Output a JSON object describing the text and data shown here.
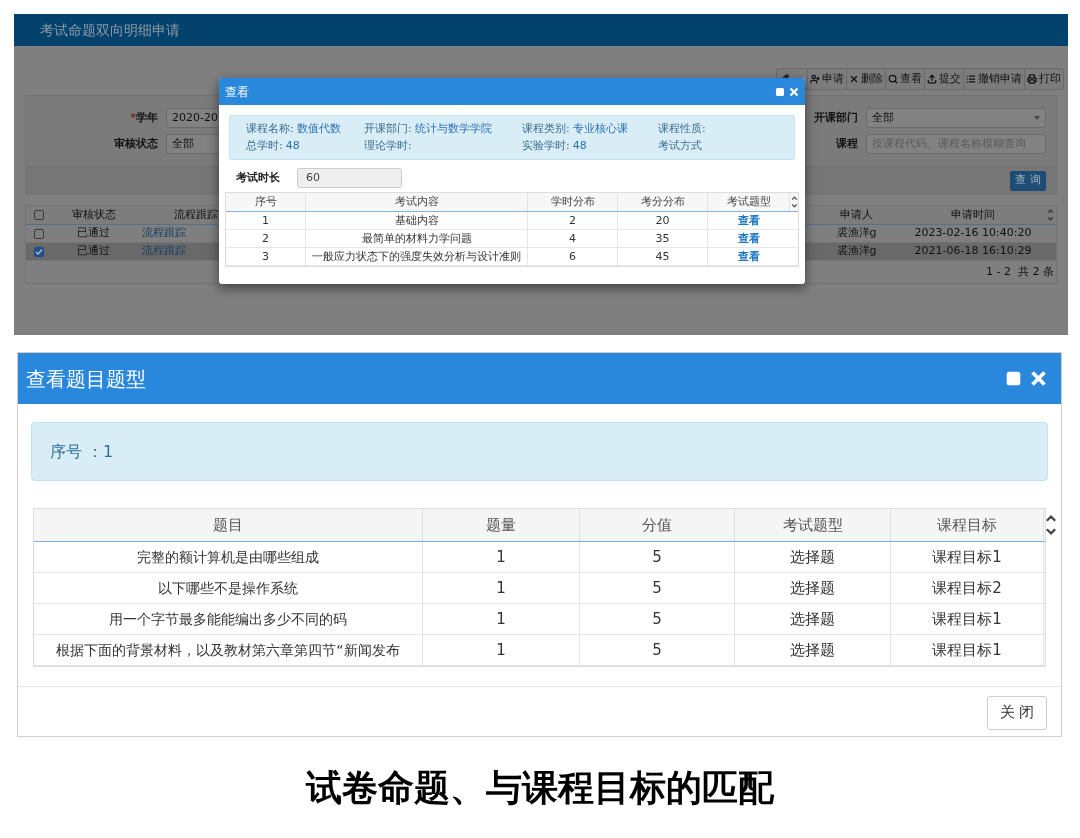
{
  "page": {
    "title": "考试命题双向明细申请",
    "toolbar": [
      {
        "kind": "edit"
      },
      {
        "kind": "apply",
        "label": "申请"
      },
      {
        "kind": "delete",
        "label": "删除"
      },
      {
        "kind": "view",
        "label": "查看"
      },
      {
        "kind": "submit",
        "label": "提交"
      },
      {
        "kind": "revoke",
        "label": "撤销申请"
      },
      {
        "kind": "print",
        "label": "打印"
      }
    ],
    "filters": [
      {
        "label": "学年",
        "required_mark": "*",
        "value": "2020-20"
      },
      {
        "label": "审核状态",
        "value": "全部"
      },
      {
        "label": "开课部门",
        "value": "全部"
      },
      {
        "label": "课程",
        "placeholder": "按课程代码、课程名称模糊查询"
      }
    ],
    "query_button": "查 询",
    "table": {
      "all_checked": false,
      "columns": [
        "审核状态",
        "流程跟踪",
        "申请人",
        "申请时间"
      ],
      "rows": [
        {
          "selected": false,
          "cells": [
            "已通过",
            "流程跟踪",
            "裘渔洋g",
            "2023-02-16 10:40:20"
          ]
        },
        {
          "selected": true,
          "cells": [
            "已通过",
            "流程跟踪",
            "裘渔洋g",
            "2021-06-18 16:10:29"
          ]
        }
      ]
    },
    "pager": "1 - 2  共 2 条"
  },
  "view_dialog": {
    "title": "查看",
    "info": [
      [
        {
          "label": "课程名称:",
          "value": "数值代数"
        },
        {
          "label": "开课部门:",
          "value": "统计与数学学院"
        },
        {
          "label": "课程类别:",
          "value": "专业核心课"
        },
        {
          "label": "课程性质:"
        }
      ],
      [
        {
          "label": "总学时:",
          "value": "48"
        },
        {
          "label": "理论学时:"
        },
        {
          "label": "实验学时:",
          "value": "48"
        },
        {
          "label": "考试方式"
        }
      ]
    ],
    "duration": {
      "label": "考试时长",
      "value": "60"
    },
    "table": {
      "columns": [
        "序号",
        "考试内容",
        "学时分布",
        "考分分布",
        "考试题型"
      ],
      "rows": [
        [
          "1",
          "基础内容",
          "2",
          "20",
          "查看"
        ],
        [
          "2",
          "最简单的材料力学问题",
          "4",
          "35",
          "查看"
        ],
        [
          "3",
          "一般应力状态下的强度失效分析与设计准则",
          "6",
          "45",
          "查看"
        ]
      ]
    }
  },
  "type_dialog": {
    "title": "查看题目题型",
    "index_label": "序号 ：1",
    "table": {
      "columns": [
        "题目",
        "题量",
        "分值",
        "考试题型",
        "课程目标"
      ],
      "rows": [
        [
          "完整的额计算机是由哪些组成",
          "1",
          "5",
          "选择题",
          "课程目标1"
        ],
        [
          "以下哪些不是操作系统",
          "1",
          "5",
          "选择题",
          "课程目标2"
        ],
        [
          "用一个字节最多能能编出多少不同的码",
          "1",
          "5",
          "选择题",
          "课程目标1"
        ],
        [
          "根据下面的背景材料，以及教材第六章第四节“新闻发布",
          "1",
          "5",
          "选择题",
          "课程目标1"
        ]
      ]
    },
    "close_button": "关 闭"
  },
  "caption": "试卷命题、与课程目标的匹配"
}
